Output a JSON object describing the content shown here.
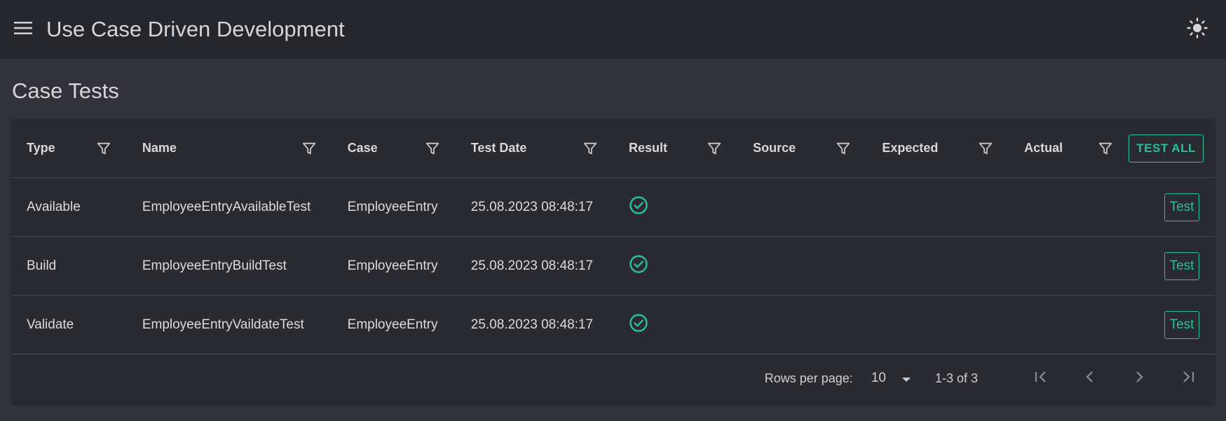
{
  "app": {
    "title": "Use Case Driven Development"
  },
  "page": {
    "title": "Case Tests"
  },
  "table": {
    "columns": [
      "Type",
      "Name",
      "Case",
      "Test Date",
      "Result",
      "Source",
      "Expected",
      "Actual"
    ],
    "test_all_label": "TEST ALL",
    "rows": [
      {
        "type": "Available",
        "name": "EmployeeEntryAvailableTest",
        "case": "EmployeeEntry",
        "test_date": "25.08.2023 08:48:17",
        "result": "passed",
        "source": "",
        "expected": "",
        "actual": "",
        "action": "Test"
      },
      {
        "type": "Build",
        "name": "EmployeeEntryBuildTest",
        "case": "EmployeeEntry",
        "test_date": "25.08.2023 08:48:17",
        "result": "passed",
        "source": "",
        "expected": "",
        "actual": "",
        "action": "Test"
      },
      {
        "type": "Validate",
        "name": "EmployeeEntryVaildateTest",
        "case": "EmployeeEntry",
        "test_date": "25.08.2023 08:48:17",
        "result": "passed",
        "source": "",
        "expected": "",
        "actual": "",
        "action": "Test"
      }
    ]
  },
  "pagination": {
    "rows_per_page_label": "Rows per page:",
    "rows_per_page_value": "10",
    "range_text": "1-3 of 3"
  },
  "icons": {
    "menu": "menu-icon",
    "theme": "sun-icon",
    "filter": "filter-funnel-icon",
    "result": "check-circle-icon",
    "first": "first-page-icon",
    "prev": "chevron-left-icon",
    "next": "chevron-right-icon",
    "last": "last-page-icon",
    "dropdown": "caret-down-icon"
  },
  "colors": {
    "accent": "#2bbf9e",
    "appbar": "#26262d",
    "background": "#32323b",
    "card": "#2a2a31"
  }
}
